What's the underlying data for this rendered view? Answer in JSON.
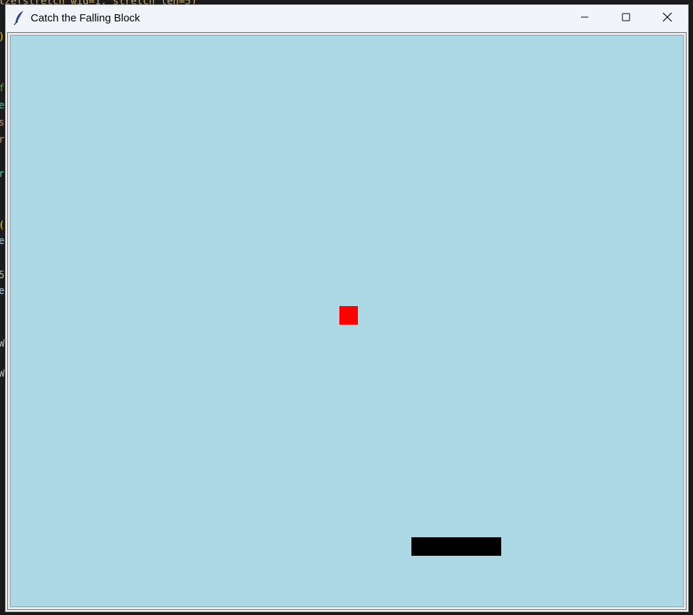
{
  "window": {
    "title": "Catch the Falling Block",
    "minimize_icon": "minimize-icon",
    "maximize_icon": "maximize-icon",
    "close_icon": "close-icon",
    "app_icon": "feather-icon"
  },
  "game": {
    "canvas_color": "#add8e6",
    "falling_block": {
      "color": "#ff0000"
    },
    "paddle": {
      "color": "#000000"
    }
  }
}
